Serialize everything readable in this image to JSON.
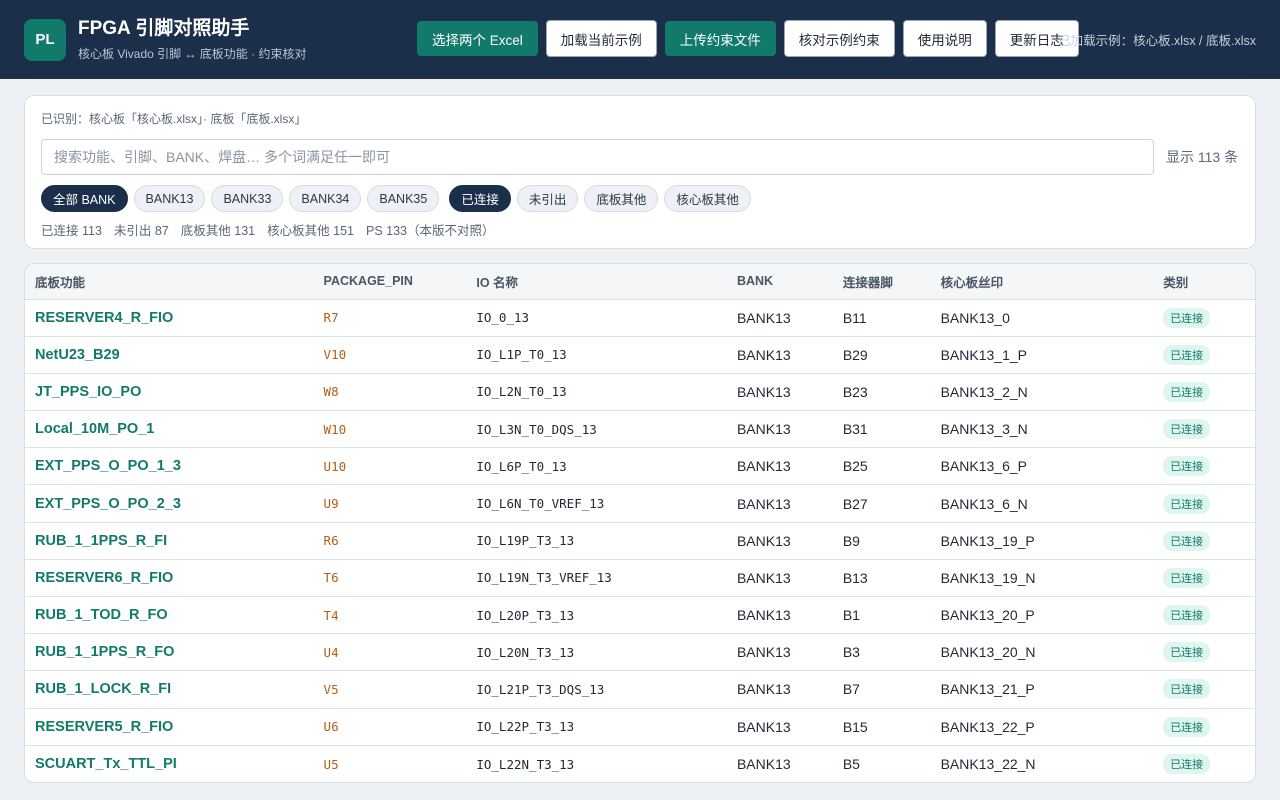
{
  "header": {
    "logo": "PL",
    "title": "FPGA 引脚对照助手",
    "subtitle": "核心板 Vivado 引脚 ↔ 底板功能 · 约束核对",
    "buttons": {
      "select_excel": "选择两个 Excel",
      "load_example": "加载当前示例",
      "upload_constraint": "上传约束文件",
      "check_constraint": "核对示例约束",
      "help": "使用说明",
      "changelog": "更新日志"
    },
    "status": "已加载示例：核心板.xlsx / 底板.xlsx"
  },
  "filter": {
    "detected": "已识别：核心板「核心板.xlsx」· 底板「底板.xlsx」",
    "search_placeholder": "搜索功能、引脚、BANK、焊盘… 多个词满足任一即可",
    "count_text": "显示 113 条",
    "bank_chips": [
      "全部 BANK",
      "BANK13",
      "BANK33",
      "BANK34",
      "BANK35"
    ],
    "status_chips": [
      "已连接",
      "未引出",
      "底板其他",
      "核心板其他"
    ],
    "stats": [
      "已连接 113",
      "未引出 87",
      "底板其他 131",
      "核心板其他 151",
      "PS 133（本版不对照）"
    ]
  },
  "table": {
    "headers": [
      "底板功能",
      "PACKAGE_PIN",
      "IO 名称",
      "BANK",
      "连接器脚",
      "核心板丝印",
      "类别"
    ],
    "rows": [
      [
        "RESERVER4_R_FIO",
        "R7",
        "IO_0_13",
        "BANK13",
        "B11",
        "BANK13_0",
        "已连接"
      ],
      [
        "NetU23_B29",
        "V10",
        "IO_L1P_T0_13",
        "BANK13",
        "B29",
        "BANK13_1_P",
        "已连接"
      ],
      [
        "JT_PPS_IO_PO",
        "W8",
        "IO_L2N_T0_13",
        "BANK13",
        "B23",
        "BANK13_2_N",
        "已连接"
      ],
      [
        "Local_10M_PO_1",
        "W10",
        "IO_L3N_T0_DQS_13",
        "BANK13",
        "B31",
        "BANK13_3_N",
        "已连接"
      ],
      [
        "EXT_PPS_O_PO_1_3",
        "U10",
        "IO_L6P_T0_13",
        "BANK13",
        "B25",
        "BANK13_6_P",
        "已连接"
      ],
      [
        "EXT_PPS_O_PO_2_3",
        "U9",
        "IO_L6N_T0_VREF_13",
        "BANK13",
        "B27",
        "BANK13_6_N",
        "已连接"
      ],
      [
        "RUB_1_1PPS_R_FI",
        "R6",
        "IO_L19P_T3_13",
        "BANK13",
        "B9",
        "BANK13_19_P",
        "已连接"
      ],
      [
        "RESERVER6_R_FIO",
        "T6",
        "IO_L19N_T3_VREF_13",
        "BANK13",
        "B13",
        "BANK13_19_N",
        "已连接"
      ],
      [
        "RUB_1_TOD_R_FO",
        "T4",
        "IO_L20P_T3_13",
        "BANK13",
        "B1",
        "BANK13_20_P",
        "已连接"
      ],
      [
        "RUB_1_1PPS_R_FO",
        "U4",
        "IO_L20N_T3_13",
        "BANK13",
        "B3",
        "BANK13_20_N",
        "已连接"
      ],
      [
        "RUB_1_LOCK_R_FI",
        "V5",
        "IO_L21P_T3_DQS_13",
        "BANK13",
        "B7",
        "BANK13_21_P",
        "已连接"
      ],
      [
        "RESERVER5_R_FIO",
        "U6",
        "IO_L22P_T3_13",
        "BANK13",
        "B15",
        "BANK13_22_P",
        "已连接"
      ],
      [
        "SCUART_Tx_TTL_PI",
        "U5",
        "IO_L22N_T3_13",
        "BANK13",
        "B5",
        "BANK13_22_N",
        "已连接"
      ]
    ]
  }
}
